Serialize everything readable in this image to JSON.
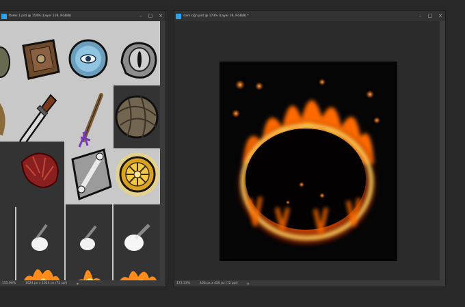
{
  "left_window": {
    "title": "Items 1.psd @ 154% (Layer 119, RGB/8)",
    "zoom": "155.96%",
    "doc_size": "1024 px x 1024 px (72 ppi)"
  },
  "right_window": {
    "title": "dark sign.psd @ 173% (Layer 19, RGB/8) *",
    "zoom": "173.33%",
    "doc_size": "400 px x 450 px (72 ppi)"
  },
  "window_controls": {
    "minimize": "–",
    "maximize": "□",
    "close": "×"
  },
  "icons": {
    "app": "photoshop-doc-icon",
    "sprites": [
      "book-icon",
      "eye-orb-icon",
      "eyeball-icon",
      "dagger-icon",
      "staff-icon",
      "rope-ball-icon",
      "red-coral-icon",
      "bone-cloth-icon",
      "golden-wheel-icon",
      "smoke-puff-icon",
      "fire-icon"
    ]
  },
  "colors": {
    "fire_outer": "#ff6a00",
    "fire_inner": "#ffd34a",
    "ps_blue": "#2aa4ef"
  }
}
